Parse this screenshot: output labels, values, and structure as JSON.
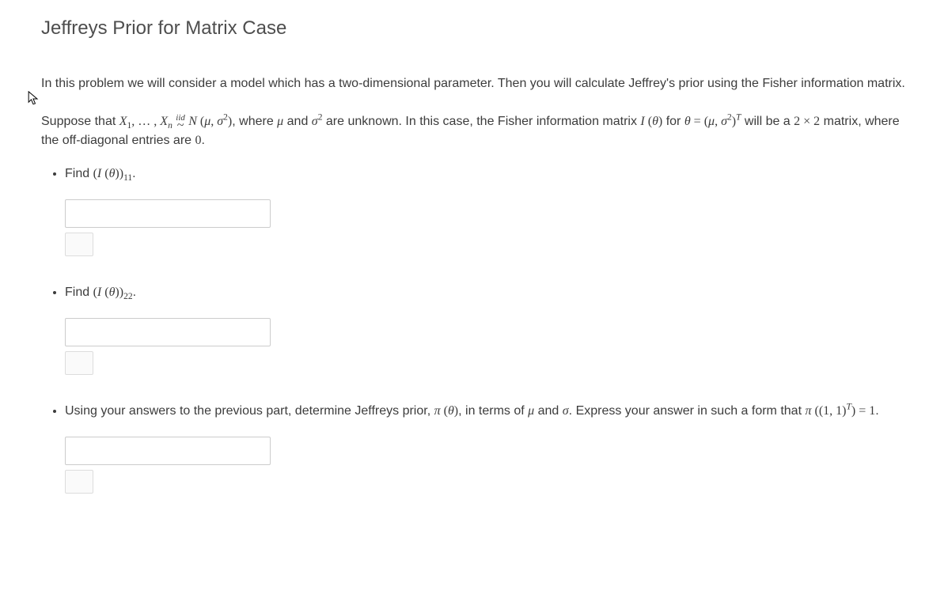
{
  "title": "Jeffreys Prior for Matrix Case",
  "intro": {
    "pre": "In this problem we will consider a model which has a two-dimensional parameter. Then you will calculate Jeffrey's prior using the Fisher information matrix."
  },
  "suppose": {
    "part1": "Suppose that ",
    "math_seq": "X₁, … , Xₙ",
    "iid_label": "iid",
    "dist": " N (μ, σ²)",
    "part2": ", where ",
    "mu": "μ",
    "and": " and ",
    "sigma2": "σ²",
    "part3": " are unknown. In this case, the Fisher information matrix ",
    "Itheta": "I (θ)",
    "for": " for ",
    "theta_eq": "θ = (μ, σ²)ᵀ",
    "part4": " will be a ",
    "twoby": "2 × 2",
    "part5": " matrix, where the off-diagonal entries are ",
    "zero": "0",
    "period": "."
  },
  "q1": {
    "find": "Find ",
    "expr": "(I (θ))",
    "sub": "11",
    "dot": "."
  },
  "q2": {
    "find": "Find ",
    "expr": "(I (θ))",
    "sub": "22",
    "dot": "."
  },
  "q3": {
    "part1": "Using your answers to the previous part, determine Jeffreys prior, ",
    "pi_theta": "π (θ)",
    "part2": ", in terms of ",
    "mu": "μ",
    "and": " and ",
    "sigma": "σ",
    "part3": ". Express your answer in such a form that ",
    "pi_one": "π ((1, 1)ᵀ) = 1",
    "dot": "."
  },
  "inputs": {
    "q1_value": "",
    "q2_value": "",
    "q3_value": ""
  }
}
